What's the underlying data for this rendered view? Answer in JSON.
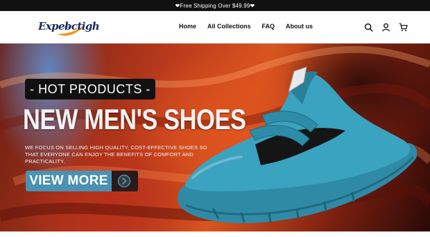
{
  "announcement": {
    "text": "❤Free Shipping Over $49.99❤"
  },
  "header": {
    "logo_text": "Expeb̶ctigh",
    "nav": [
      "Home",
      "All Collections",
      "FAQ",
      "About us"
    ]
  },
  "icons": {
    "search": "search-icon",
    "account": "user-icon",
    "cart": "cart-icon",
    "cta_arrow": "chevron-right-icon"
  },
  "hero": {
    "badge": "- HOT PRODUCTS -",
    "headline": "NEW MEN'S SHOES",
    "subtext": "WE FOCUS ON SELLING HIGH QUALITY, COST-EFFECTIVE SHOES SO THAT EVERYONE CAN ENJOY THE BENEFITS OF COMFORT AND PRACTICALITY.",
    "cta": "VIEW MORE"
  },
  "colors": {
    "announcement_bg": "#111111",
    "brand_navy": "#1b2a55",
    "brand_orange": "#f29a1f",
    "cta_blue": "#4a91b3",
    "shoe_teal": "#3aa3bf"
  }
}
